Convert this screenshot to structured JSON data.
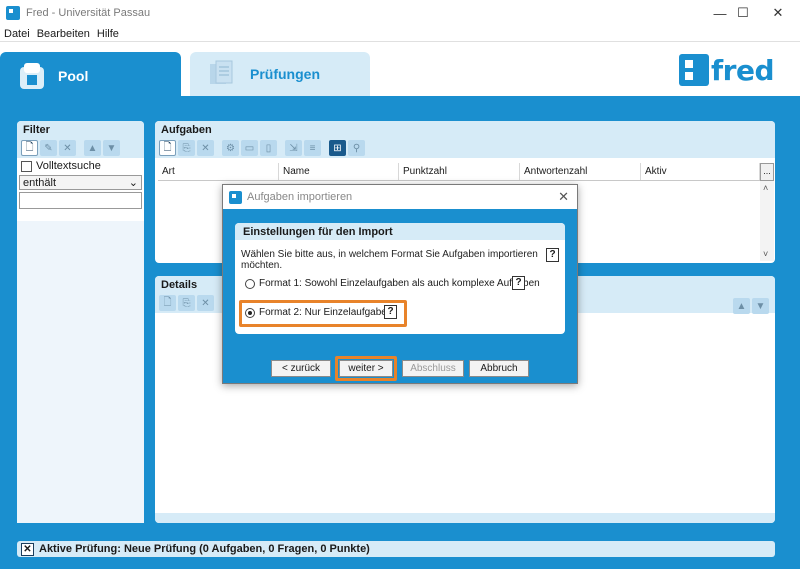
{
  "window": {
    "title": "Fred - Universität Passau",
    "minimize_glyph": "—",
    "maximize_glyph": "☐",
    "close_glyph": "✕"
  },
  "menu": [
    "Datei",
    "Bearbeiten",
    "Hilfe"
  ],
  "tabs": {
    "pool": "Pool",
    "pruefungen": "Prüfungen"
  },
  "logo": {
    "text": "fred"
  },
  "filter": {
    "title": "Filter",
    "volltext_label": "Volltextsuche",
    "operator_value": "enthält",
    "search_value": ""
  },
  "aufgaben": {
    "title": "Aufgaben",
    "columns": [
      "Art",
      "Name",
      "Punktzahl",
      "Antwortenzahl",
      "Aktiv"
    ],
    "more_label": "..."
  },
  "details": {
    "title": "Details"
  },
  "status": {
    "text": "Aktive Prüfung: Neue Prüfung (0 Aufgaben, 0 Fragen, 0 Punkte)"
  },
  "dialog": {
    "title": "Aufgaben importieren",
    "section_title": "Einstellungen für den Import",
    "question": "Wählen Sie bitte aus, in welchem Format Sie Aufgaben importieren möchten.",
    "help_glyph": "?",
    "option1": "Format 1: Sowohl Einzelaufgaben als auch komplexe Aufgaben",
    "option2": "Format 2: Nur Einzelaufgaben",
    "selected_option": 2,
    "buttons": {
      "back": "< zurück",
      "next": "weiter >",
      "finish": "Abschluss",
      "cancel": "Abbruch"
    }
  },
  "colors": {
    "brand_blue": "#1a8fcf",
    "panel_header": "#d6ebf7",
    "highlight": "#e8832a"
  }
}
